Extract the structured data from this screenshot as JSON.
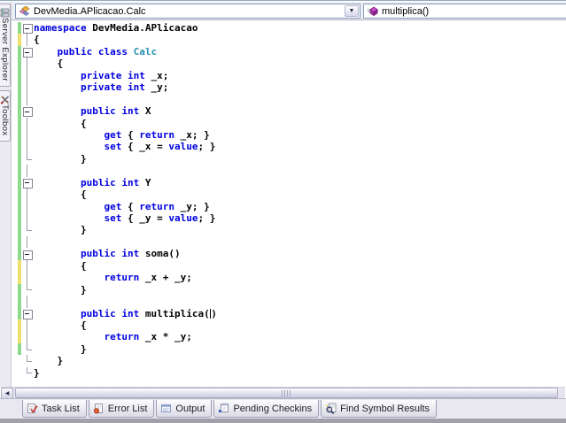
{
  "theme": {
    "kw": "#0000e0",
    "ty": "#2b91af",
    "green": "#8fd98f",
    "yellow": "#efe06e"
  },
  "sidebar": {
    "tabs": [
      {
        "label": "Server Explorer",
        "icon": "server-explorer-icon"
      },
      {
        "label": "Toolbox",
        "icon": "toolbox-icon"
      }
    ]
  },
  "navigation_bar": {
    "types_dropdown": {
      "value": "DevMedia.APlicacao.Calc",
      "icon": "class-icon"
    },
    "members_dropdown": {
      "value": "multiplica()",
      "icon": "method-icon"
    }
  },
  "editor": {
    "caret_after_text": "multiplica(",
    "lines": [
      {
        "outline": "box",
        "change": "green",
        "s": [
          {
            "c": "kw",
            "t": "namespace"
          },
          {
            "c": "pl",
            "t": " DevMedia.APlicacao"
          }
        ]
      },
      {
        "outline": "v",
        "change": "yellow",
        "s": [
          {
            "c": "pl",
            "t": "{"
          }
        ]
      },
      {
        "outline": "box",
        "change": "green",
        "s": [
          {
            "c": "pl",
            "t": "    "
          },
          {
            "c": "kw",
            "t": "public class"
          },
          {
            "c": "ty",
            "t": " Calc"
          }
        ]
      },
      {
        "outline": "v",
        "change": "green",
        "s": [
          {
            "c": "pl",
            "t": "    {"
          }
        ]
      },
      {
        "outline": "v",
        "change": "green",
        "s": [
          {
            "c": "pl",
            "t": "        "
          },
          {
            "c": "kw",
            "t": "private int"
          },
          {
            "c": "pl",
            "t": " _x;"
          }
        ]
      },
      {
        "outline": "v",
        "change": "green",
        "s": [
          {
            "c": "pl",
            "t": "        "
          },
          {
            "c": "kw",
            "t": "private int"
          },
          {
            "c": "pl",
            "t": " _y;"
          }
        ]
      },
      {
        "outline": "v",
        "change": "green",
        "s": []
      },
      {
        "outline": "box",
        "change": "green",
        "s": [
          {
            "c": "pl",
            "t": "        "
          },
          {
            "c": "kw",
            "t": "public int"
          },
          {
            "c": "pl",
            "t": " X"
          }
        ]
      },
      {
        "outline": "v",
        "change": "green",
        "s": [
          {
            "c": "pl",
            "t": "        {"
          }
        ]
      },
      {
        "outline": "v",
        "change": "green",
        "s": [
          {
            "c": "pl",
            "t": "            "
          },
          {
            "c": "kw",
            "t": "get"
          },
          {
            "c": "pl",
            "t": " { "
          },
          {
            "c": "kw",
            "t": "return"
          },
          {
            "c": "pl",
            "t": " _x; }"
          }
        ]
      },
      {
        "outline": "v",
        "change": "green",
        "s": [
          {
            "c": "pl",
            "t": "            "
          },
          {
            "c": "kw",
            "t": "set"
          },
          {
            "c": "pl",
            "t": " { _x = "
          },
          {
            "c": "kw",
            "t": "value"
          },
          {
            "c": "pl",
            "t": "; }"
          }
        ]
      },
      {
        "outline": "end",
        "change": "green",
        "s": [
          {
            "c": "pl",
            "t": "        }"
          }
        ]
      },
      {
        "outline": "v",
        "change": "green",
        "s": []
      },
      {
        "outline": "box",
        "change": "green",
        "s": [
          {
            "c": "pl",
            "t": "        "
          },
          {
            "c": "kw",
            "t": "public int"
          },
          {
            "c": "pl",
            "t": " Y"
          }
        ]
      },
      {
        "outline": "v",
        "change": "green",
        "s": [
          {
            "c": "pl",
            "t": "        {"
          }
        ]
      },
      {
        "outline": "v",
        "change": "green",
        "s": [
          {
            "c": "pl",
            "t": "            "
          },
          {
            "c": "kw",
            "t": "get"
          },
          {
            "c": "pl",
            "t": " { "
          },
          {
            "c": "kw",
            "t": "return"
          },
          {
            "c": "pl",
            "t": " _y; }"
          }
        ]
      },
      {
        "outline": "v",
        "change": "green",
        "s": [
          {
            "c": "pl",
            "t": "            "
          },
          {
            "c": "kw",
            "t": "set"
          },
          {
            "c": "pl",
            "t": " { _y = "
          },
          {
            "c": "kw",
            "t": "value"
          },
          {
            "c": "pl",
            "t": "; }"
          }
        ]
      },
      {
        "outline": "end",
        "change": "green",
        "s": [
          {
            "c": "pl",
            "t": "        }"
          }
        ]
      },
      {
        "outline": "v",
        "change": "green",
        "s": []
      },
      {
        "outline": "box",
        "change": "green",
        "s": [
          {
            "c": "pl",
            "t": "        "
          },
          {
            "c": "kw",
            "t": "public int"
          },
          {
            "c": "pl",
            "t": " soma()"
          }
        ]
      },
      {
        "outline": "v",
        "change": "yellow",
        "s": [
          {
            "c": "pl",
            "t": "        {"
          }
        ]
      },
      {
        "outline": "v",
        "change": "yellow",
        "s": [
          {
            "c": "pl",
            "t": "            "
          },
          {
            "c": "kw",
            "t": "return"
          },
          {
            "c": "pl",
            "t": " _x + _y;"
          }
        ]
      },
      {
        "outline": "end",
        "change": "green",
        "s": [
          {
            "c": "pl",
            "t": "        }"
          }
        ]
      },
      {
        "outline": "v",
        "change": "green",
        "s": []
      },
      {
        "outline": "box",
        "change": "green",
        "s": [
          {
            "c": "pl",
            "t": "        "
          },
          {
            "c": "kw",
            "t": "public int"
          },
          {
            "c": "pl",
            "t": " multiplica("
          },
          {
            "c": "caret",
            "t": ""
          },
          {
            "c": "pl",
            "t": ")"
          }
        ]
      },
      {
        "outline": "v",
        "change": "yellow",
        "s": [
          {
            "c": "pl",
            "t": "        {"
          }
        ]
      },
      {
        "outline": "v",
        "change": "yellow",
        "s": [
          {
            "c": "pl",
            "t": "            "
          },
          {
            "c": "kw",
            "t": "return"
          },
          {
            "c": "pl",
            "t": " _x * _y;"
          }
        ]
      },
      {
        "outline": "end",
        "change": "green",
        "s": [
          {
            "c": "pl",
            "t": "        }"
          }
        ]
      },
      {
        "outline": "end",
        "change": "",
        "s": [
          {
            "c": "pl",
            "t": "    }"
          }
        ]
      },
      {
        "outline": "end",
        "change": "",
        "s": [
          {
            "c": "pl",
            "t": "}"
          }
        ]
      }
    ]
  },
  "bottom_tabs": [
    {
      "label": "Task List",
      "icon": "task-list-icon"
    },
    {
      "label": "Error List",
      "icon": "error-list-icon"
    },
    {
      "label": "Output",
      "icon": "output-icon"
    },
    {
      "label": "Pending Checkins",
      "icon": "pending-checkins-icon"
    },
    {
      "label": "Find Symbol Results",
      "icon": "find-symbol-results-icon"
    }
  ]
}
